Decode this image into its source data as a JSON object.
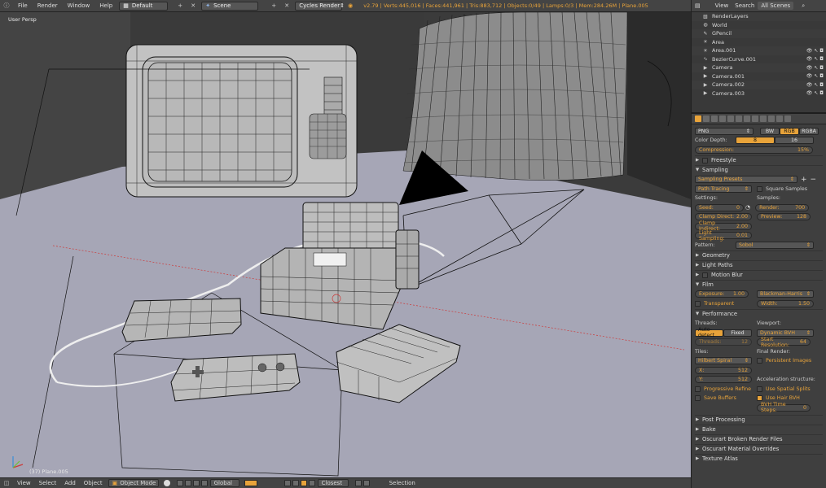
{
  "topbar": {
    "menus": [
      "File",
      "Render",
      "Window",
      "Help"
    ],
    "screen_layout": "Default",
    "scene": "Scene",
    "render_engine": "Cycles Render",
    "stats": "v2.79 | Verts:445,016 | Faces:441,961 | Tris:883,712 | Objects:0/49 | Lamps:0/3 | Mem:284.26M | Plane.005"
  },
  "viewport": {
    "view_label": "User Persp",
    "object_label": "(37) Plane.005"
  },
  "bottombar": {
    "menus": [
      "View",
      "Select",
      "Add",
      "Object"
    ],
    "mode": "Object Mode",
    "orientation": "Global",
    "snap": "Closest",
    "selection": "Selection"
  },
  "outliner": {
    "header": [
      "View",
      "Search",
      "All Scenes"
    ],
    "items": [
      {
        "name": "RenderLayers",
        "icon": "render-layers-icon"
      },
      {
        "name": "World",
        "icon": "world-icon"
      },
      {
        "name": "GPencil",
        "icon": "grease-pencil-icon"
      },
      {
        "name": "Area",
        "icon": "lamp-icon"
      },
      {
        "name": "Area.001",
        "icon": "lamp-icon"
      },
      {
        "name": "BezierCurve.001",
        "icon": "curve-icon"
      },
      {
        "name": "Camera",
        "icon": "camera-icon"
      },
      {
        "name": "Camera.001",
        "icon": "camera-icon"
      },
      {
        "name": "Camera.002",
        "icon": "camera-icon"
      },
      {
        "name": "Camera.003",
        "icon": "camera-icon"
      }
    ]
  },
  "props": {
    "format": "PNG",
    "color_modes": [
      "BW",
      "RGB",
      "RGBA"
    ],
    "color_depth_label": "Color Depth:",
    "color_depth": [
      "8",
      "16"
    ],
    "compression_label": "Compression:",
    "compression": "15%",
    "freestyle": "Freestyle",
    "sampling": "Sampling",
    "sampling_presets": "Sampling Presets",
    "integrator": "Path Tracing",
    "square_samples": "Square Samples",
    "settings_label": "Settings:",
    "samples_label": "Samples:",
    "seed_label": "Seed:",
    "seed": "0",
    "clamp_direct_label": "Clamp Direct:",
    "clamp_direct": "2.00",
    "clamp_indirect_label": "Clamp Indirect:",
    "clamp_indirect": "2.00",
    "light_sampling_label": "Light Sampling:",
    "light_sampling": "0.01",
    "render_label": "Render:",
    "render_samples": "700",
    "preview_label": "Preview:",
    "preview_samples": "128",
    "pattern_label": "Pattern:",
    "pattern": "Sobol",
    "geometry": "Geometry",
    "light_paths": "Light Paths",
    "motion_blur": "Motion Blur",
    "film": "Film",
    "exposure_label": "Exposure:",
    "exposure": "1.00",
    "filter": "Blackman-Harris",
    "transparent": "Transparent",
    "width_label": "Width:",
    "width": "1.50",
    "performance": "Performance",
    "threads_label": "Threads:",
    "threads_modes": [
      "Auto-detect",
      "Fixed"
    ],
    "threads_count_label": "Threads:",
    "threads_count": "12",
    "viewport_label": "Viewport:",
    "bvh": "Dynamic BVH",
    "start_resolution_label": "Start Resolution:",
    "start_resolution": "64",
    "tiles_label": "Tiles:",
    "tile_order": "Hilbert Spiral",
    "tile_x_label": "X:",
    "tile_x": "512",
    "tile_y_label": "Y:",
    "tile_y": "512",
    "final_render_label": "Final Render:",
    "persistent_images": "Persistent Images",
    "accel_label": "Acceleration structure:",
    "progressive_refine": "Progressive Refine",
    "use_spatial_splits": "Use Spatial Splits",
    "save_buffers": "Save Buffers",
    "use_hair_bvh": "Use Hair BVH",
    "bvh_time_steps_label": "BVH Time Steps:",
    "bvh_time_steps": "0",
    "post_processing": "Post Processing",
    "bake": "Bake",
    "oscurart_broken": "Oscurart Broken Render Files",
    "oscurart_material": "Oscurart Material Overrides",
    "texture_atlas": "Texture Atlas"
  },
  "colors": {
    "accent": "#e8a33a",
    "selected_text": "#e8a33a",
    "floor": "#a6a6b6",
    "wall": "#3c3c3c"
  }
}
